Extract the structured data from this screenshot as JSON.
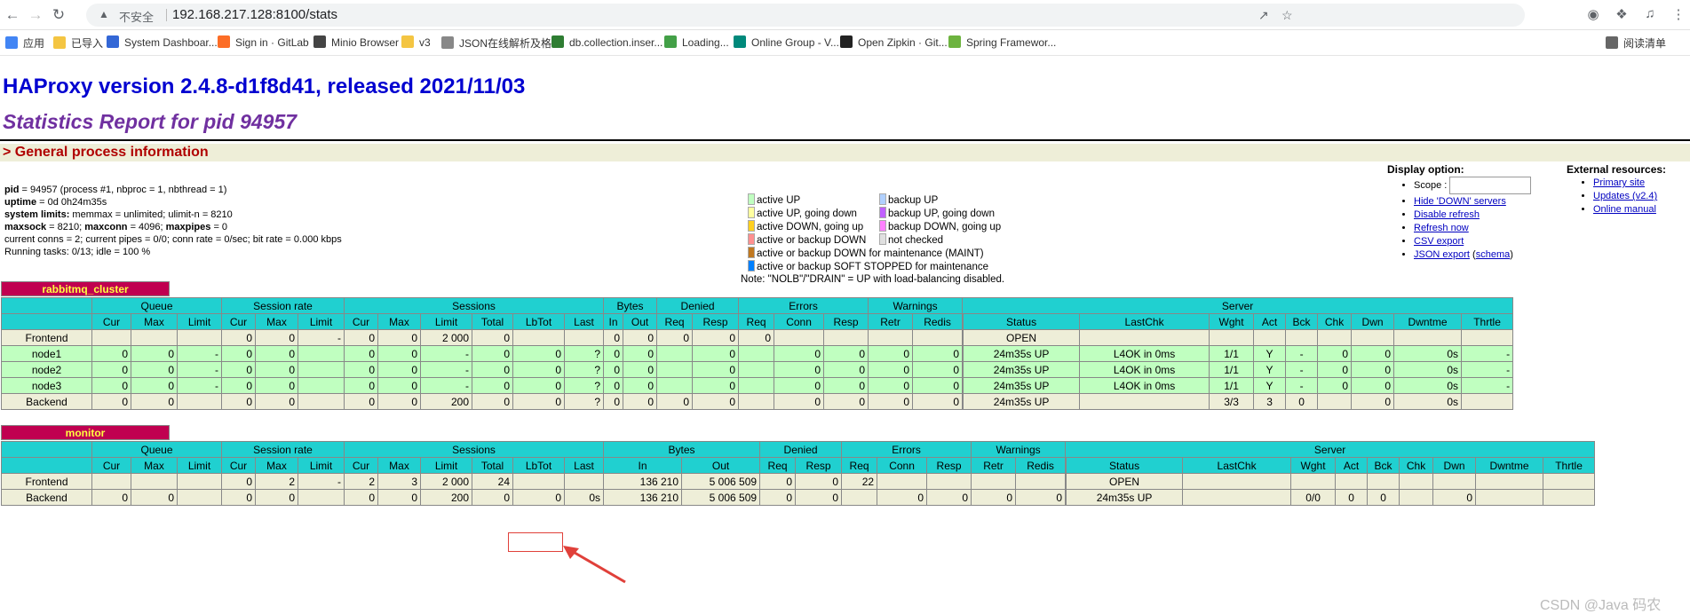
{
  "browser": {
    "insecure_label": "不安全",
    "url": "192.168.217.128:8100/stats"
  },
  "bookmarks": [
    {
      "label": "应用",
      "color": "#4285f4"
    },
    {
      "label": "已导入",
      "color": "#f4c542"
    },
    {
      "label": "System Dashboar...",
      "color": "#3367d6"
    },
    {
      "label": "Sign in · GitLab",
      "color": "#fc6d26"
    },
    {
      "label": "Minio Browser",
      "color": "#444444"
    },
    {
      "label": "v3",
      "color": "#f4c542"
    },
    {
      "label": "JSON在线解析及格...",
      "color": "#888888"
    },
    {
      "label": "db.collection.inser...",
      "color": "#2e7d32"
    },
    {
      "label": "Loading...",
      "color": "#43a047"
    },
    {
      "label": "Online Group - V...",
      "color": "#00897b"
    },
    {
      "label": "Open Zipkin · Git...",
      "color": "#222222"
    },
    {
      "label": "Spring Framewor...",
      "color": "#6db33f"
    },
    {
      "label": "阅读清单",
      "color": "#666666"
    }
  ],
  "page": {
    "title": "HAProxy version 2.4.8-d1f8d41, released 2021/11/03",
    "subtitle": "Statistics Report for pid 94957",
    "section": "> General process information"
  },
  "procinfo": [
    {
      "b": "pid",
      "t": " = 94957 (process #1, nbproc = 1, nbthread = 1)"
    },
    {
      "b": "uptime",
      "t": " = 0d 0h24m35s"
    },
    {
      "b": "system limits:",
      "t": " memmax = unlimited; ulimit-n = 8210"
    },
    {
      "b": "maxsock",
      "t": " = 8210; ",
      "b2": "maxconn",
      "t2": " = 4096; ",
      "b3": "maxpipes",
      "t3": " = 0"
    },
    {
      "b": "",
      "t": "current conns = 2; current pipes = 0/0; conn rate = 0/sec; bit rate = 0.000 kbps"
    },
    {
      "b": "",
      "t": "Running tasks: 0/13; idle = 100 %"
    }
  ],
  "legend": {
    "left": [
      {
        "label": "active UP",
        "color": "#c0ffc0"
      },
      {
        "label": "active UP, going down",
        "color": "#ffffa0"
      },
      {
        "label": "active DOWN, going up",
        "color": "#ffd020"
      },
      {
        "label": "active or backup DOWN",
        "color": "#ff9090"
      },
      {
        "label": "active or backup DOWN for maintenance (MAINT)",
        "color": "#c07820"
      },
      {
        "label": "active or backup SOFT STOPPED for maintenance",
        "color": "#0080ff"
      }
    ],
    "right": [
      {
        "label": "backup UP",
        "color": "#b0d0ff"
      },
      {
        "label": "backup UP, going down",
        "color": "#c060ff"
      },
      {
        "label": "backup DOWN, going up",
        "color": "#ff80ff"
      },
      {
        "label": "not checked",
        "color": "#e0e0e0"
      }
    ],
    "note": "Note: \"NOLB\"/\"DRAIN\" = UP with load-balancing disabled."
  },
  "display": {
    "title": "Display option:",
    "scope": "Scope :",
    "links": [
      "Hide 'DOWN' servers",
      "Disable refresh",
      "Refresh now",
      "CSV export"
    ],
    "json": "JSON export",
    "schema": "schema"
  },
  "external": {
    "title": "External resources:",
    "links": [
      "Primary site",
      "Updates (v2.4)",
      "Online manual"
    ]
  },
  "proxies": [
    {
      "name": "rabbitmq_cluster",
      "rows": [
        {
          "kind": "fe",
          "cells": [
            "Frontend",
            "",
            "",
            "",
            "0",
            "0",
            "-",
            "0",
            "0",
            "2 000",
            "0",
            "",
            "",
            "0",
            "0",
            "0",
            "0",
            "0",
            "",
            "",
            "",
            "",
            "",
            "OPEN",
            "",
            "",
            "",
            "",
            "",
            "",
            "",
            ""
          ]
        },
        {
          "kind": "up",
          "cells": [
            "node1",
            "0",
            "0",
            "-",
            "0",
            "0",
            "",
            "0",
            "0",
            "-",
            "0",
            "0",
            "?",
            "0",
            "0",
            "",
            "0",
            "",
            "0",
            "0",
            "0",
            "0",
            "0",
            "24m35s UP",
            "L4OK in 0ms",
            "1/1",
            "Y",
            "-",
            "0",
            "0",
            "0s",
            "-"
          ]
        },
        {
          "kind": "up",
          "cells": [
            "node2",
            "0",
            "0",
            "-",
            "0",
            "0",
            "",
            "0",
            "0",
            "-",
            "0",
            "0",
            "?",
            "0",
            "0",
            "",
            "0",
            "",
            "0",
            "0",
            "0",
            "0",
            "0",
            "24m35s UP",
            "L4OK in 0ms",
            "1/1",
            "Y",
            "-",
            "0",
            "0",
            "0s",
            "-"
          ]
        },
        {
          "kind": "up",
          "cells": [
            "node3",
            "0",
            "0",
            "-",
            "0",
            "0",
            "",
            "0",
            "0",
            "-",
            "0",
            "0",
            "?",
            "0",
            "0",
            "",
            "0",
            "",
            "0",
            "0",
            "0",
            "0",
            "0",
            "24m35s UP",
            "L4OK in 0ms",
            "1/1",
            "Y",
            "-",
            "0",
            "0",
            "0s",
            "-"
          ]
        },
        {
          "kind": "be",
          "cells": [
            "Backend",
            "0",
            "0",
            "",
            "0",
            "0",
            "",
            "0",
            "0",
            "200",
            "0",
            "0",
            "?",
            "0",
            "0",
            "0",
            "0",
            "",
            "0",
            "0",
            "0",
            "0",
            "0",
            "24m35s UP",
            "",
            "3/3",
            "3",
            "0",
            "",
            "0",
            "0s",
            ""
          ]
        }
      ]
    },
    {
      "name": "monitor",
      "rows": [
        {
          "kind": "fe",
          "cells": [
            "Frontend",
            "",
            "",
            "",
            "0",
            "2",
            "-",
            "2",
            "3",
            "2 000",
            "24",
            "",
            "",
            "136 210",
            "5 006 509",
            "0",
            "0",
            "22",
            "",
            "",
            "",
            "",
            "",
            "OPEN",
            "",
            "",
            "",
            "",
            "",
            "",
            "",
            ""
          ]
        },
        {
          "kind": "be",
          "cells": [
            "Backend",
            "0",
            "0",
            "",
            "0",
            "0",
            "",
            "0",
            "0",
            "200",
            "0",
            "0",
            "0s",
            "136 210",
            "5 006 509",
            "0",
            "0",
            "",
            "0",
            "0",
            "0",
            "0",
            "",
            "24m35s UP",
            "",
            "0/0",
            "0",
            "0",
            "",
            "0",
            "",
            ""
          ]
        }
      ]
    }
  ],
  "headers": {
    "groups": [
      [
        "",
        1
      ],
      [
        "Queue",
        3
      ],
      [
        "Session rate",
        3
      ],
      [
        "Sessions",
        6
      ],
      [
        "Bytes",
        2
      ],
      [
        "Denied",
        2
      ],
      [
        "Errors",
        3
      ],
      [
        "Warnings",
        2
      ],
      [
        "Server",
        10
      ]
    ],
    "cols": [
      "",
      "Cur",
      "Max",
      "Limit",
      "Cur",
      "Max",
      "Limit",
      "Cur",
      "Max",
      "Limit",
      "Total",
      "LbTot",
      "Last",
      "In",
      "Out",
      "Req",
      "Resp",
      "Req",
      "Conn",
      "Resp",
      "Retr",
      "Redis",
      "",
      "Status",
      "LastChk",
      "Wght",
      "Act",
      "Bck",
      "Chk",
      "Dwn",
      "Dwntme",
      "Thrtle"
    ]
  },
  "watermark": "CSDN @Java 码农"
}
